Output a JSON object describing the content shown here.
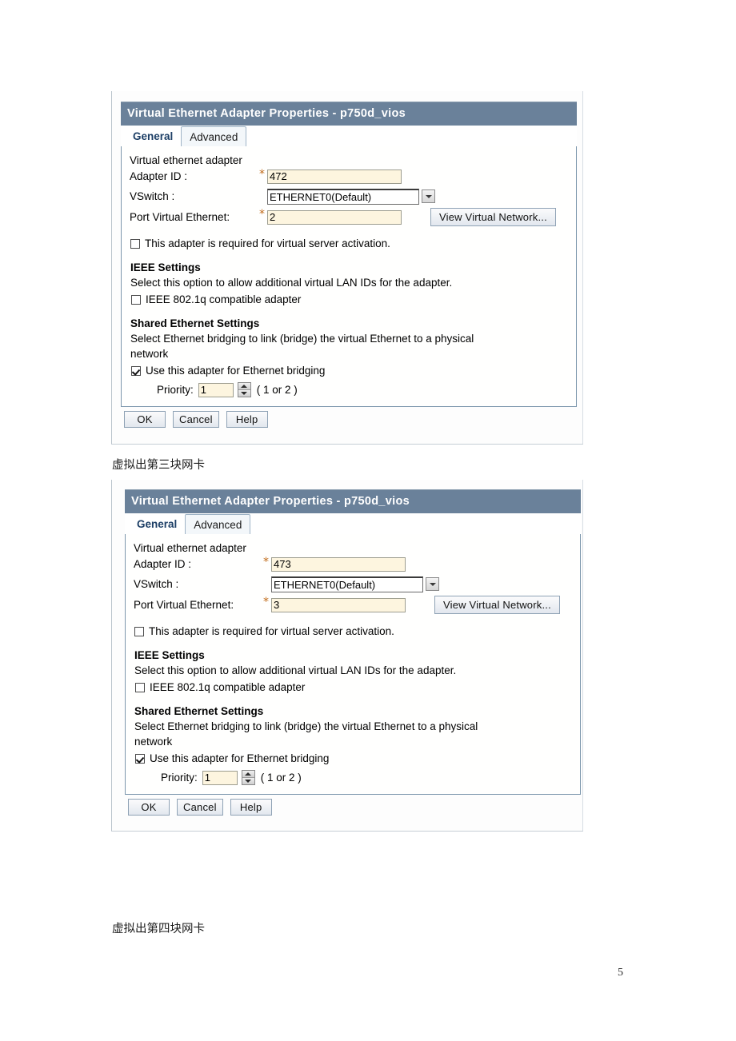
{
  "page": {
    "page_number": "5",
    "note_third_card": "虚拟出第三块网卡",
    "note_fourth_card": "虚拟出第四块网卡"
  },
  "dialogs": [
    {
      "title": "Virtual Ethernet Adapter Properties - p750d_vios",
      "tabs": [
        {
          "label": "General",
          "active": true
        },
        {
          "label": "Advanced",
          "active": false
        }
      ],
      "section_title": "Virtual ethernet adapter",
      "fields": {
        "adapter_id_label": "Adapter ID :",
        "adapter_id_value": "472",
        "adapter_id_required_marker": "*",
        "vswitch_label": "VSwitch :",
        "vswitch_value": "ETHERNET0(Default)",
        "port_virtual_ethernet_label": "Port Virtual Ethernet:",
        "port_virtual_ethernet_value": "2",
        "port_virtual_ethernet_required_marker": "*",
        "view_virtual_network_button": "View Virtual Network..."
      },
      "required_checkbox": {
        "label": "This adapter is required for virtual server activation.",
        "checked": false
      },
      "ieee": {
        "heading": "IEEE Settings",
        "description": "Select this option to allow additional virtual LAN IDs for the adapter.",
        "checkbox_label": "IEEE 802.1q compatible adapter",
        "checked": false
      },
      "shared_ethernet": {
        "heading": "Shared Ethernet Settings",
        "description_line1": "Select Ethernet bridging to link (bridge) the virtual Ethernet to a physical",
        "description_line2": "network",
        "checkbox_label": "Use this adapter for Ethernet bridging",
        "checked": true,
        "priority_label": "Priority:",
        "priority_value": "1",
        "priority_hint": "( 1 or 2 )"
      },
      "buttons": {
        "ok": "OK",
        "cancel": "Cancel",
        "help": "Help"
      }
    },
    {
      "title": "Virtual Ethernet Adapter Properties - p750d_vios",
      "tabs": [
        {
          "label": "General",
          "active": true
        },
        {
          "label": "Advanced",
          "active": false
        }
      ],
      "section_title": "Virtual ethernet adapter",
      "fields": {
        "adapter_id_label": "Adapter ID :",
        "adapter_id_value": "473",
        "adapter_id_required_marker": "*",
        "vswitch_label": "VSwitch :",
        "vswitch_value": "ETHERNET0(Default)",
        "port_virtual_ethernet_label": "Port Virtual Ethernet:",
        "port_virtual_ethernet_value": "3",
        "port_virtual_ethernet_required_marker": "*",
        "view_virtual_network_button": "View Virtual Network..."
      },
      "required_checkbox": {
        "label": "This adapter is required for virtual server activation.",
        "checked": false
      },
      "ieee": {
        "heading": "IEEE Settings",
        "description": "Select this option to allow additional virtual LAN IDs for the adapter.",
        "checkbox_label": "IEEE 802.1q compatible adapter",
        "checked": false
      },
      "shared_ethernet": {
        "heading": "Shared Ethernet Settings",
        "description_line1": "Select Ethernet bridging to link (bridge) the virtual Ethernet to a physical",
        "description_line2": "network",
        "checkbox_label": "Use this adapter for Ethernet bridging",
        "checked": true,
        "priority_label": "Priority:",
        "priority_value": "1",
        "priority_hint": "( 1 or 2 )"
      },
      "buttons": {
        "ok": "OK",
        "cancel": "Cancel",
        "help": "Help"
      }
    }
  ],
  "colors": {
    "titlebar": "#6a819a",
    "panel_border": "#7d97ad",
    "required_field_bg": "#fdf5df",
    "required_marker": "#c06a18",
    "active_tab_text": "#1d3f66"
  }
}
